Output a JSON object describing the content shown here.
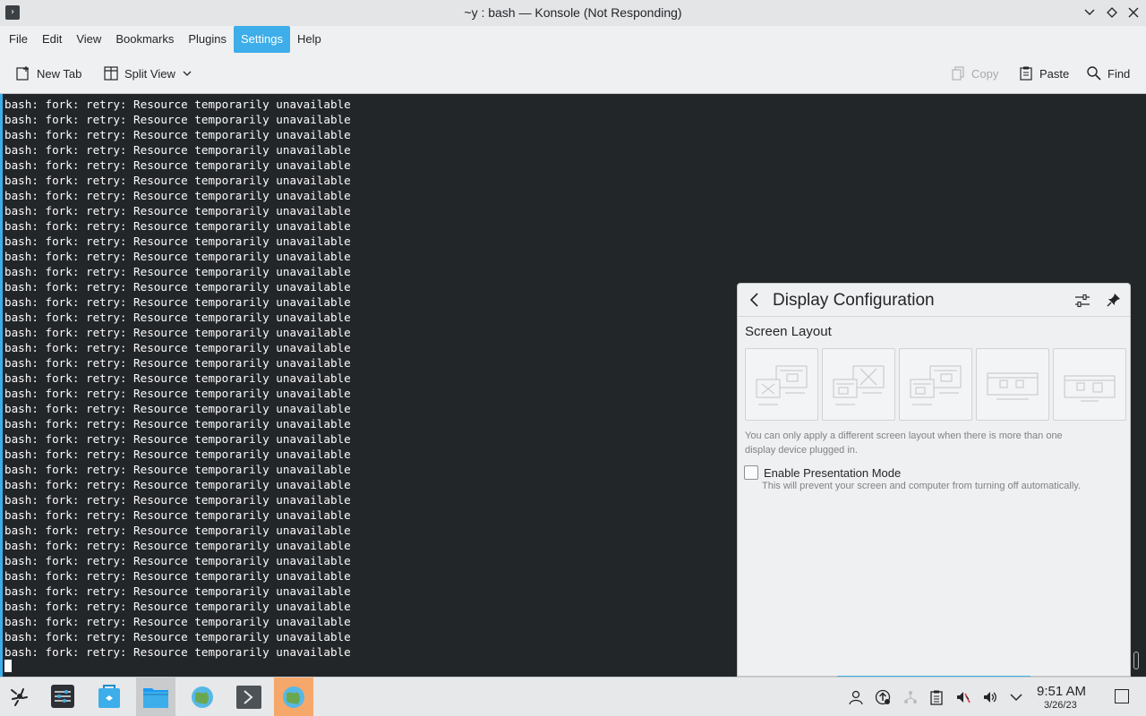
{
  "window": {
    "title": "~y : bash — Konsole (Not Responding)",
    "app_icon": "terminal-icon"
  },
  "menu": {
    "items": [
      "File",
      "Edit",
      "View",
      "Bookmarks",
      "Plugins",
      "Settings",
      "Help"
    ],
    "active": "Settings"
  },
  "toolbar": {
    "new_tab": "New Tab",
    "split_view": "Split View",
    "copy": "Copy",
    "paste": "Paste",
    "find": "Find"
  },
  "terminal": {
    "line": "bash: fork: retry: Resource temporarily unavailable",
    "line_count": 37
  },
  "popup": {
    "title": "Display Configuration",
    "section_title": "Screen Layout",
    "hint": "You can only apply a different screen layout when there is more than one display device plugged in.",
    "presentation_label": "Enable Presentation Mode",
    "presentation_desc": "This will prevent your screen and computer from turning off automatically.",
    "presentation_checked": false
  },
  "taskbar": {
    "apps": [
      "application-launcher-icon",
      "system-settings-icon",
      "discover-icon",
      "file-manager-icon",
      "web-browser-icon",
      "terminal-icon",
      "web-browser-icon-active"
    ],
    "tray": [
      "user-icon",
      "updates-icon",
      "network-icon",
      "clipboard-icon",
      "notifications-muted-icon",
      "volume-icon",
      "tray-expand-icon"
    ],
    "time": "9:51 AM",
    "date": "3/26/23"
  },
  "colors": {
    "accent": "#3daee9",
    "terminal_bg": "#232629",
    "terminal_fg": "#fcfcfc"
  }
}
